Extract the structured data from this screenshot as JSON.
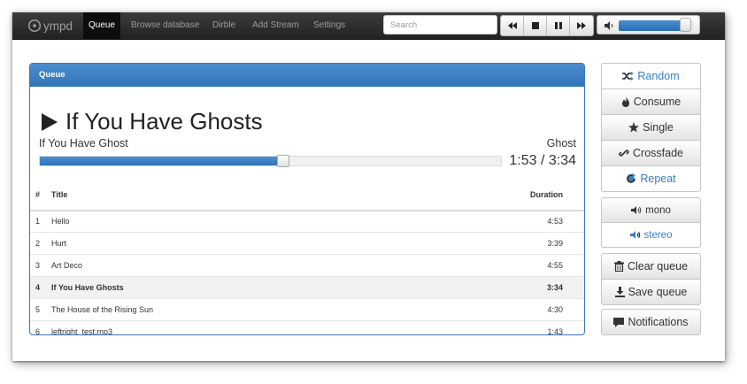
{
  "navbar": {
    "brand": "ympd",
    "items": [
      {
        "label": "Queue",
        "active": true
      },
      {
        "label": "Browse database",
        "active": false
      },
      {
        "label": "Dirble",
        "active": false
      },
      {
        "label": "Add Stream",
        "active": false
      },
      {
        "label": "Settings",
        "active": false
      }
    ],
    "search_placeholder": "Search",
    "player_buttons": [
      "previous-icon",
      "stop-icon",
      "pause-icon",
      "next-icon"
    ],
    "volume_level": 0.85
  },
  "queue": {
    "heading": "Queue",
    "now_playing": {
      "title": "If You Have Ghosts",
      "artist": "If You Have Ghost",
      "album": "Ghost",
      "time": "1:53 / 3:34",
      "progress": 0.528
    },
    "columns": {
      "num": "#",
      "title": "Title",
      "duration": "Duration"
    },
    "rows": [
      {
        "num": "1",
        "title": "Hello",
        "duration": "4:53",
        "current": false
      },
      {
        "num": "2",
        "title": "Hurt",
        "duration": "3:39",
        "current": false
      },
      {
        "num": "3",
        "title": "Art Deco",
        "duration": "4:55",
        "current": false
      },
      {
        "num": "4",
        "title": "If You Have Ghosts",
        "duration": "3:34",
        "current": true
      },
      {
        "num": "5",
        "title": "The House of the Rising Sun",
        "duration": "4:30",
        "current": false
      },
      {
        "num": "6",
        "title": "leftright_test.mp3",
        "duration": "1:43",
        "current": false
      }
    ]
  },
  "sidebar": {
    "modes": [
      {
        "label": "Random",
        "icon": "shuffle-icon",
        "active": true
      },
      {
        "label": "Consume",
        "icon": "fire-icon",
        "active": false
      },
      {
        "label": "Single",
        "icon": "star-icon",
        "active": false
      },
      {
        "label": "Crossfade",
        "icon": "link-icon",
        "active": false
      },
      {
        "label": "Repeat",
        "icon": "repeat-icon",
        "active": true
      }
    ],
    "channels": [
      {
        "label": "mono",
        "icon": "speaker-icon",
        "active": false
      },
      {
        "label": "stereo",
        "icon": "speaker-icon",
        "active": true
      }
    ],
    "clear_queue": "Clear queue",
    "save_queue": "Save queue",
    "notifications": "Notifications"
  },
  "colors": {
    "accent": "#3a7ec2",
    "navbar": "#2b2b2b"
  }
}
